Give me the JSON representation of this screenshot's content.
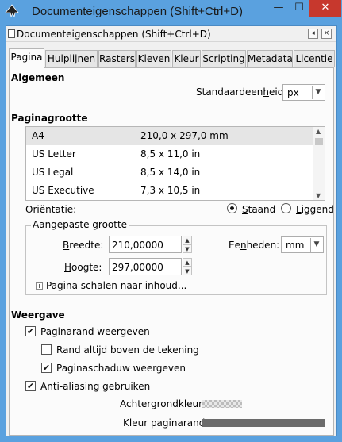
{
  "window": {
    "title": "Documenteigenschappen (Shift+Ctrl+D)",
    "minimize": "—",
    "maximize": "☐",
    "close": "✕"
  },
  "dock": {
    "title": "Documenteigenschappen (Shift+Ctrl+D)",
    "btn_close": "×",
    "btn_back": "◂"
  },
  "tabs": [
    "Pagina",
    "Hulplijnen",
    "Rasters",
    "Kleven",
    "Kleur",
    "Scripting",
    "Metadata",
    "Licentie"
  ],
  "algemeen": {
    "heading": "Algemeen",
    "unit_label_pre": "Standaardeen",
    "unit_label_u": "h",
    "unit_label_post": "eid:",
    "unit_value": "px"
  },
  "paginagrootte": {
    "heading": "Paginagrootte",
    "sizes": [
      {
        "name": "A4",
        "dims": "210,0 x 297,0 mm",
        "selected": true
      },
      {
        "name": "US Letter",
        "dims": "8,5 x 11,0 in"
      },
      {
        "name": "US Legal",
        "dims": "8,5 x 14,0 in"
      },
      {
        "name": "US Executive",
        "dims": "7,3 x 10,5 in"
      }
    ],
    "orientation_label": "Oriëntatie:",
    "portrait": "Staand",
    "portrait_u": "S",
    "landscape": "Liggend",
    "landscape_u": "L",
    "custom_heading": "Aangepaste grootte",
    "width_label": "Breedte:",
    "width_u": "B",
    "width_value": "210,00000",
    "height_label": "Hoogte:",
    "height_u": "H",
    "height_value": "297,00000",
    "units_label_pre": "Ee",
    "units_label_u": "n",
    "units_label_post": "heden:",
    "units_value": "mm",
    "scale_expander": "Pagina schalen naar inhoud...",
    "scale_u": "P"
  },
  "weergave": {
    "heading": "Weergave",
    "options": [
      {
        "label": "Paginarand weergeven",
        "checked": true
      },
      {
        "label": "Rand altijd boven de tekening",
        "checked": false
      },
      {
        "label": "Paginaschaduw weergeven",
        "checked": true
      },
      {
        "label": "Anti-aliasing gebruiken",
        "checked": true
      }
    ],
    "background_label": "Achtergrondkleur:",
    "border_color_label": "Kleur paginarand:",
    "border_color": "#6b6b6b"
  },
  "colors": {
    "titlebar": "#5aa1df",
    "close": "#c7382d"
  }
}
